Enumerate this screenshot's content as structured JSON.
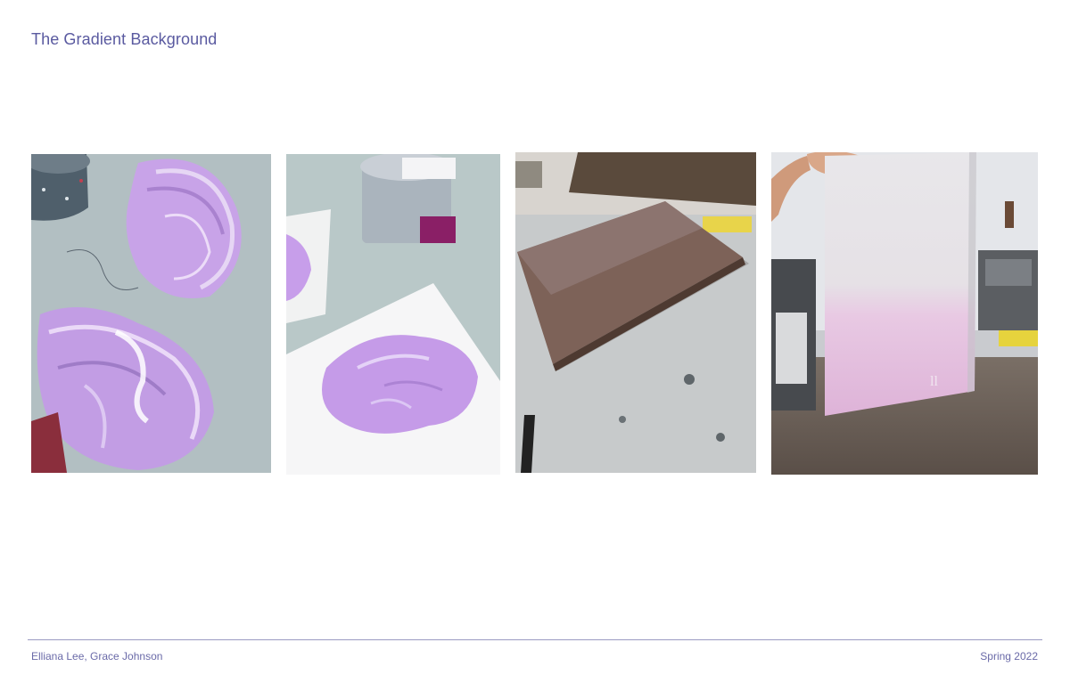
{
  "page": {
    "title": "The Gradient Background"
  },
  "photos": [
    {
      "subject": "palette-ink-smears",
      "dominant_color": "#c9a6e6"
    },
    {
      "subject": "ink-can-and-paper",
      "dominant_color": "#c59be8"
    },
    {
      "subject": "inking-board",
      "dominant_color": "#7d6258"
    },
    {
      "subject": "printed-gradient-sheet",
      "dominant_color": "#e3b7dc"
    }
  ],
  "footer": {
    "authors": "Elliana Lee, Grace Johnson",
    "term": "Spring 2022"
  },
  "colors": {
    "accent": "#5a5aa0",
    "rule": "#9a9ac2",
    "ink_lilac": "#c6a0e8"
  }
}
